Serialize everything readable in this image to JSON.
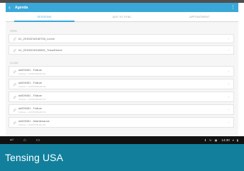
{
  "app_bar": {
    "title": "Agenda"
  },
  "tabs": [
    {
      "label": "SESSIONS"
    },
    {
      "label": "ADD TO SYNC"
    },
    {
      "label": "APPOINTMENT"
    }
  ],
  "sections": [
    {
      "label": "OPEN",
      "rows": [
        {
          "main": "#1_20150218160706_Lunch",
          "sub": ""
        },
        {
          "main": "#1_20150218160651_TravelHome",
          "sub": ""
        }
      ]
    },
    {
      "label": "CLOSE",
      "rows": [
        {
          "main": "sk009451 - Failure",
          "sub": "Software - HOPPROBLEM 811"
        },
        {
          "main": "sk009451 - Failure",
          "sub": "Software - HOPPROBLEM 812"
        },
        {
          "main": "sk009451 - Failure",
          "sub": "Software - HOPPROBLEM 813"
        },
        {
          "main": "sk009451 - Failure",
          "sub": "Software - HOPPROBLEM 814"
        },
        {
          "main": "sk009451 - Maintenance",
          "sub": "Software - HOPPROBLEM 815"
        }
      ]
    }
  ],
  "status_bar": {
    "time": "14:30"
  },
  "caption": "Tensing USA",
  "colors": {
    "accent": "#39a8d9",
    "caption_bg": "#12809d",
    "navbar": "#111111"
  }
}
